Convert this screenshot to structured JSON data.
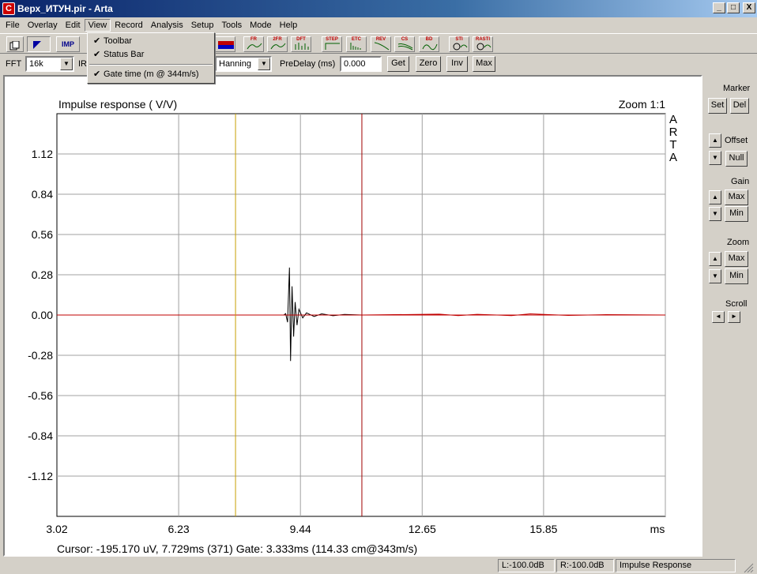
{
  "window": {
    "title": "Верх_ИТУН.pir - Arta",
    "app_icon_glyph": "C"
  },
  "window_buttons": {
    "minimize": "_",
    "maximize": "□",
    "close": "X"
  },
  "menu": [
    "File",
    "Overlay",
    "Edit",
    "View",
    "Record",
    "Analysis",
    "Setup",
    "Tools",
    "Mode",
    "Help"
  ],
  "view_menu": {
    "toolbar": "Toolbar",
    "status_bar": "Status Bar",
    "gate_time": "Gate time  (m @ 344m/s)",
    "check": "✔"
  },
  "toolbar_icons": {
    "imp": "IMP",
    "fr": "FR",
    "fr2": "2FR",
    "dft": "DFT",
    "step": "STEP",
    "etc": "ETC",
    "rev": "REV",
    "cs": "CS",
    "bd": "BD",
    "sti": "STI",
    "rasti": "RASTI"
  },
  "toolbar2": {
    "fft_label": "FFT",
    "fft_value": "16k",
    "ir_label": "IR",
    "window_value": "Hanning",
    "predelay_label": "PreDelay (ms)",
    "predelay_value": "0.000",
    "get": "Get",
    "zero": "Zero",
    "inv": "Inv",
    "max": "Max"
  },
  "side_panel": {
    "marker": "Marker",
    "set": "Set",
    "del": "Del",
    "offset": "Offset",
    "null": "Null",
    "gain": "Gain",
    "gain_max": "Max",
    "gain_min": "Min",
    "zoom": "Zoom",
    "zoom_max": "Max",
    "zoom_min": "Min",
    "scroll": "Scroll",
    "up": "▲",
    "down": "▼",
    "left": "◄",
    "right": "►"
  },
  "chart_data": {
    "type": "line",
    "title": "Impulse response ( V/V)",
    "zoom_label": "Zoom 1:1",
    "watermark": [
      "A",
      "R",
      "T",
      "A"
    ],
    "xlabel": "ms",
    "x_ticks": [
      "3.02",
      "6.23",
      "9.44",
      "12.65",
      "15.85"
    ],
    "xlim": [
      3.02,
      19.06
    ],
    "y_ticks": [
      "1.12",
      "0.84",
      "0.56",
      "0.28",
      "0.00",
      "-0.28",
      "-0.56",
      "-0.84",
      "-1.12"
    ],
    "ylim": [
      -1.4,
      1.4
    ],
    "markers_ms": {
      "gate_start": 7.729,
      "gate_end": 11.06
    },
    "series": [
      {
        "values": [
          [
            7.729,
            0
          ],
          [
            9.0,
            0
          ],
          [
            9.05,
            0.01
          ],
          [
            9.1,
            -0.05
          ],
          [
            9.15,
            0.33
          ],
          [
            9.18,
            -0.32
          ],
          [
            9.22,
            0.2
          ],
          [
            9.26,
            -0.15
          ],
          [
            9.3,
            0.09
          ],
          [
            9.35,
            -0.07
          ],
          [
            9.4,
            0.04
          ],
          [
            9.5,
            -0.02
          ],
          [
            9.6,
            0.015
          ],
          [
            9.8,
            -0.01
          ],
          [
            10.0,
            0.008
          ],
          [
            10.3,
            -0.005
          ],
          [
            10.6,
            0.004
          ],
          [
            11.06,
            0
          ]
        ]
      },
      {
        "values": [
          [
            3.02,
            0
          ],
          [
            7.729,
            0
          ],
          [
            11.06,
            0
          ],
          [
            13.1,
            0.006
          ],
          [
            13.6,
            -0.004
          ],
          [
            14.1,
            0.005
          ],
          [
            15.0,
            -0.004
          ],
          [
            15.5,
            0.008
          ],
          [
            16.5,
            -0.003
          ],
          [
            17.5,
            0.003
          ],
          [
            19.06,
            0
          ]
        ]
      }
    ],
    "colors": {
      "response": "#000000",
      "outside_gate": "#c00000",
      "gate_start_marker": "#c8a000",
      "gate_end_marker": "#a00000",
      "grid": "#a0a0a0"
    },
    "grid": true
  },
  "cursor_readout": "Cursor: -195.170 uV, 7.729ms (371)  Gate: 3.333ms (114.33 cm@343m/s)",
  "status_bar": {
    "left": "L:-100.0dB",
    "right": "R:-100.0dB",
    "mode": "Impulse Response"
  }
}
